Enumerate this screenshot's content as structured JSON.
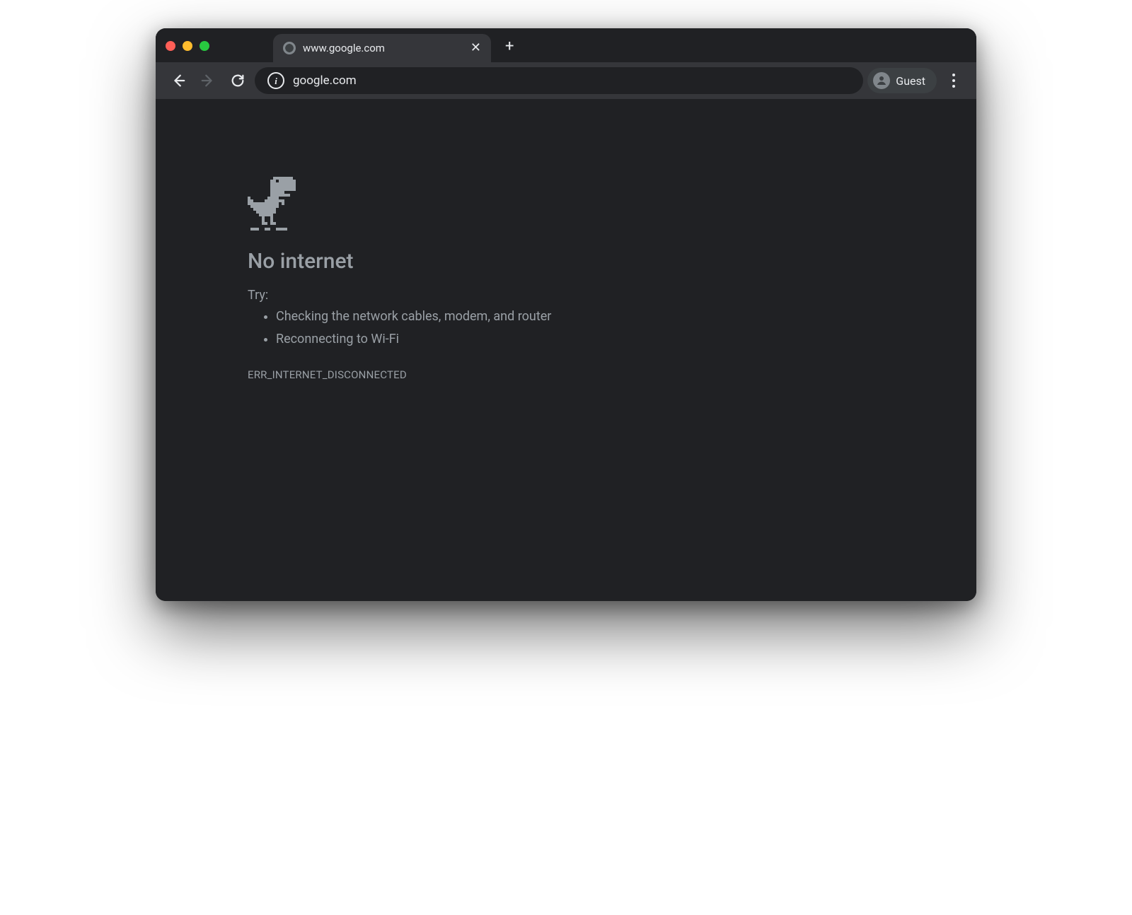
{
  "tabs": [
    {
      "title": "www.google.com"
    }
  ],
  "toolbar": {
    "url": "google.com"
  },
  "profile": {
    "label": "Guest"
  },
  "error": {
    "heading": "No internet",
    "try_label": "Try:",
    "suggestions": [
      "Checking the network cables, modem, and router",
      "Reconnecting to Wi-Fi"
    ],
    "code": "ERR_INTERNET_DISCONNECTED"
  }
}
